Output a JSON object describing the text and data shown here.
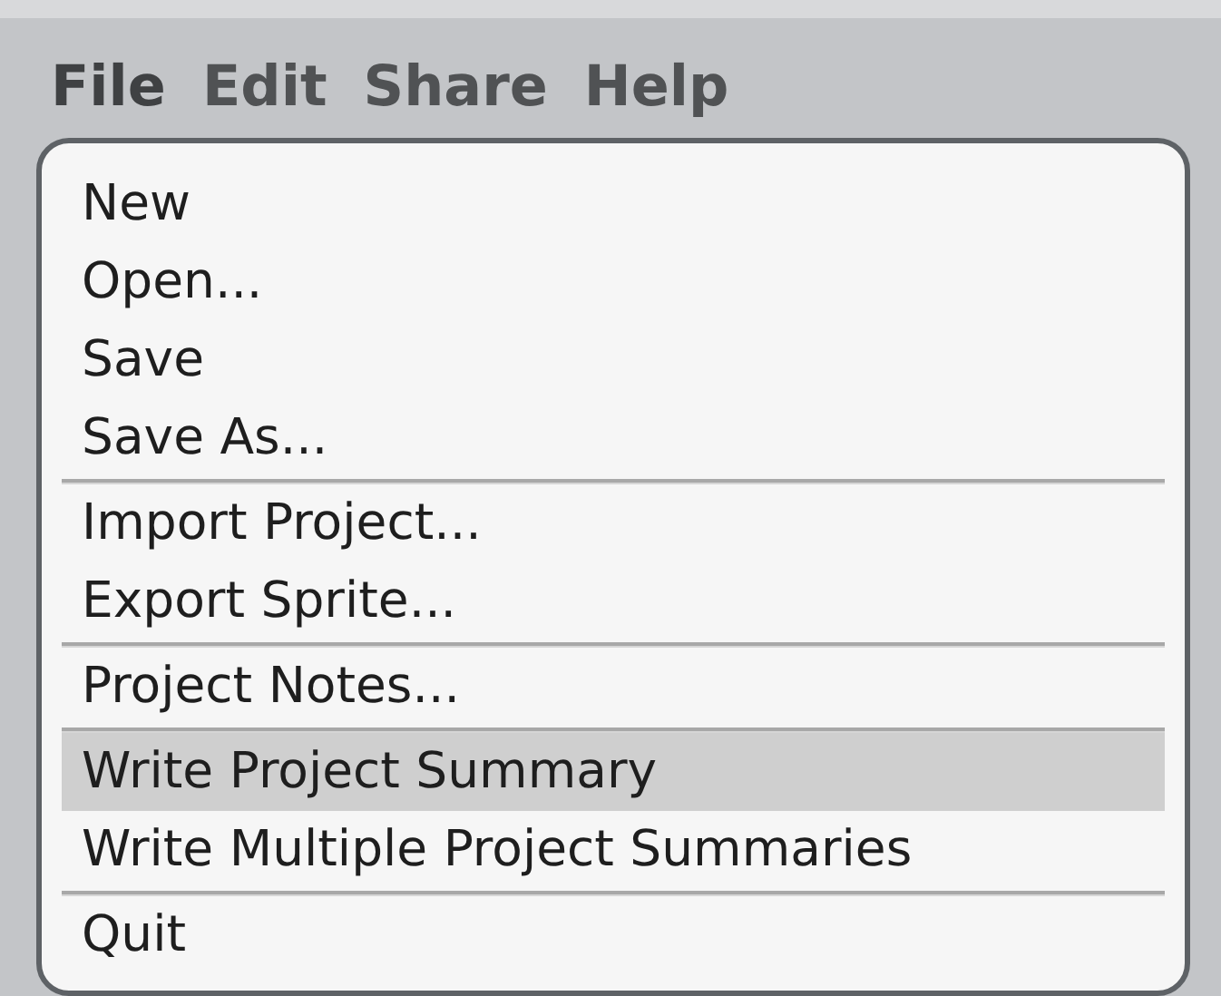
{
  "menubar": [
    {
      "label": "File",
      "selected": true
    },
    {
      "label": "Edit",
      "selected": false
    },
    {
      "label": "Share",
      "selected": false
    },
    {
      "label": "Help",
      "selected": false
    }
  ],
  "menu": {
    "groups": [
      [
        {
          "label": "New",
          "selected": false
        },
        {
          "label": "Open...",
          "selected": false
        },
        {
          "label": "Save",
          "selected": false
        },
        {
          "label": "Save As...",
          "selected": false
        }
      ],
      [
        {
          "label": "Import Project...",
          "selected": false
        },
        {
          "label": "Export Sprite...",
          "selected": false
        }
      ],
      [
        {
          "label": "Project Notes...",
          "selected": false
        }
      ],
      [
        {
          "label": "Write Project Summary",
          "selected": true
        },
        {
          "label": "Write Multiple Project Summaries",
          "selected": false
        }
      ],
      [
        {
          "label": "Quit",
          "selected": false
        }
      ]
    ]
  }
}
